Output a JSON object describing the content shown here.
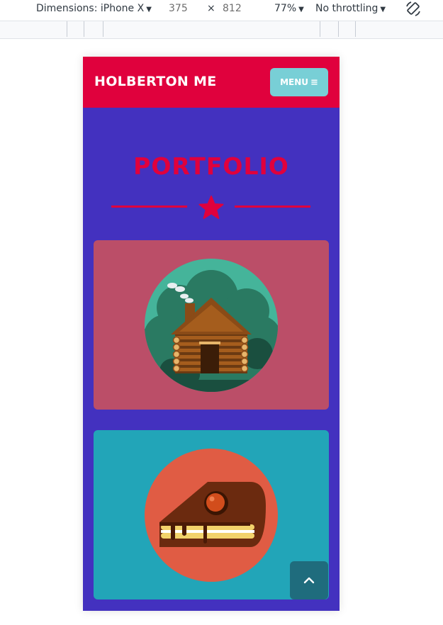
{
  "devtools": {
    "dimensions_label": "Dimensions: iPhone X",
    "width": "375",
    "times": "×",
    "height": "812",
    "zoom": "77%",
    "throttling": "No throttling"
  },
  "site": {
    "brand": "HOLBERTON ME",
    "menu_label": "MENU",
    "menu_icon": "≡",
    "section_title": "PORTFOLIO"
  },
  "portfolio": {
    "items": [
      {
        "icon": "log-cabin-icon",
        "background": "#bb4e68"
      },
      {
        "icon": "cake-slice-icon",
        "background": "#22a5b8"
      }
    ]
  },
  "colors": {
    "accent": "#e0013d",
    "page_background": "#4331bf",
    "menu_button": "#78cfd6",
    "scroll_button": "#1f6c7d"
  }
}
